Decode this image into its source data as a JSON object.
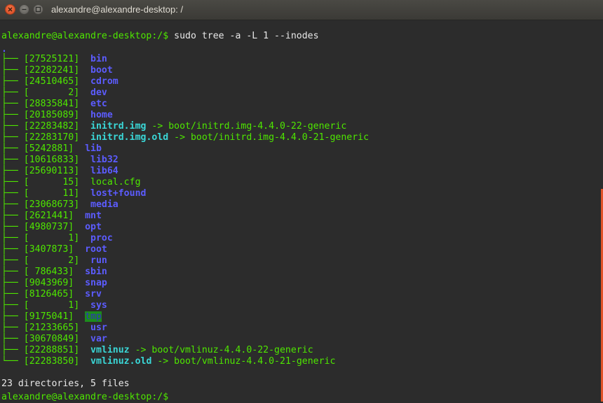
{
  "window": {
    "title": "alexandre@alexandre-desktop: /",
    "buttons": {
      "close": "close-icon",
      "minimize": "minimize-icon",
      "maximize": "maximize-icon"
    }
  },
  "colors": {
    "background": "#2c2c2c",
    "prompt_green": "#4ee600",
    "directory_blue": "#5c5cff",
    "symlink_cyan": "#3ad7d7",
    "tmp_highlight_bg": "#1c8c1c",
    "scrollbar": "#e0542a"
  },
  "terminal": {
    "command_prompt": "alexandre@alexandre-desktop:/$",
    "command": " sudo tree -a -L 1 --inodes",
    "root_dot": ".",
    "entries": [
      {
        "branch": "├── ",
        "inode": "[27525121]",
        "name": "bin",
        "type": "dir",
        "target": ""
      },
      {
        "branch": "├── ",
        "inode": "[22282241]",
        "name": "boot",
        "type": "dir",
        "target": ""
      },
      {
        "branch": "├── ",
        "inode": "[24510465]",
        "name": "cdrom",
        "type": "dir",
        "target": ""
      },
      {
        "branch": "├── ",
        "inode": "[       2]",
        "name": "dev",
        "type": "dir",
        "target": ""
      },
      {
        "branch": "├── ",
        "inode": "[28835841]",
        "name": "etc",
        "type": "dir",
        "target": ""
      },
      {
        "branch": "├── ",
        "inode": "[20185089]",
        "name": "home",
        "type": "dir",
        "target": ""
      },
      {
        "branch": "├── ",
        "inode": "[22283482]",
        "name": "initrd.img",
        "type": "link",
        "target": "boot/initrd.img-4.4.0-22-generic"
      },
      {
        "branch": "├── ",
        "inode": "[22283170]",
        "name": "initrd.img.old",
        "type": "link",
        "target": "boot/initrd.img-4.4.0-21-generic"
      },
      {
        "branch": "├── ",
        "inode": "[5242881]",
        "name": "lib",
        "type": "dir",
        "target": ""
      },
      {
        "branch": "├── ",
        "inode": "[10616833]",
        "name": "lib32",
        "type": "dir",
        "target": ""
      },
      {
        "branch": "├── ",
        "inode": "[25690113]",
        "name": "lib64",
        "type": "dir",
        "target": ""
      },
      {
        "branch": "├── ",
        "inode": "[      15]",
        "name": "local.cfg",
        "type": "file",
        "target": ""
      },
      {
        "branch": "├── ",
        "inode": "[      11]",
        "name": "lost+found",
        "type": "dir",
        "target": ""
      },
      {
        "branch": "├── ",
        "inode": "[23068673]",
        "name": "media",
        "type": "dir",
        "target": ""
      },
      {
        "branch": "├── ",
        "inode": "[2621441]",
        "name": "mnt",
        "type": "dir",
        "target": ""
      },
      {
        "branch": "├── ",
        "inode": "[4980737]",
        "name": "opt",
        "type": "dir",
        "target": ""
      },
      {
        "branch": "├── ",
        "inode": "[       1]",
        "name": "proc",
        "type": "dir",
        "target": ""
      },
      {
        "branch": "├── ",
        "inode": "[3407873]",
        "name": "root",
        "type": "dir",
        "target": ""
      },
      {
        "branch": "├── ",
        "inode": "[       2]",
        "name": "run",
        "type": "dir",
        "target": ""
      },
      {
        "branch": "├── ",
        "inode": "[ 786433]",
        "name": "sbin",
        "type": "dir",
        "target": ""
      },
      {
        "branch": "├── ",
        "inode": "[9043969]",
        "name": "snap",
        "type": "dir",
        "target": ""
      },
      {
        "branch": "├── ",
        "inode": "[8126465]",
        "name": "srv",
        "type": "dir",
        "target": ""
      },
      {
        "branch": "├── ",
        "inode": "[       1]",
        "name": "sys",
        "type": "dir",
        "target": ""
      },
      {
        "branch": "├── ",
        "inode": "[9175041]",
        "name": "tmp",
        "type": "tmp",
        "target": ""
      },
      {
        "branch": "├── ",
        "inode": "[21233665]",
        "name": "usr",
        "type": "dir",
        "target": ""
      },
      {
        "branch": "├── ",
        "inode": "[30670849]",
        "name": "var",
        "type": "dir",
        "target": ""
      },
      {
        "branch": "├── ",
        "inode": "[22288851]",
        "name": "vmlinuz",
        "type": "link",
        "target": "boot/vmlinuz-4.4.0-22-generic"
      },
      {
        "branch": "└── ",
        "inode": "[22283850]",
        "name": "vmlinuz.old",
        "type": "link",
        "target": "boot/vmlinuz-4.4.0-21-generic"
      }
    ],
    "arrow": " -> ",
    "summary": "23 directories, 5 files",
    "final_prompt": "alexandre@alexandre-desktop:/$"
  }
}
